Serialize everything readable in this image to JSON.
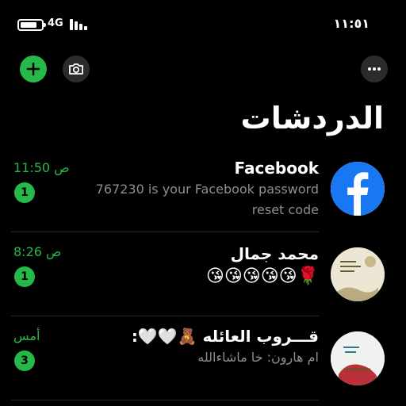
{
  "status_bar": {
    "network": "4G",
    "time": "١١:٥١"
  },
  "header": {
    "title": "الدردشات"
  },
  "chats": [
    {
      "name": "Facebook",
      "preview": "767230 is your Facebook password reset code",
      "time": "11:50 ص",
      "unread": "1",
      "avatar": "facebook-logo"
    },
    {
      "name": "محمد جمال",
      "preview": "😘😘😘😘😘🌹",
      "time": "8:26 ص",
      "unread": "1",
      "avatar": "photo"
    },
    {
      "name": "قـــروب العائله 🧸🤍🤍:",
      "preview": "ام هارون: خا ماشاءالله",
      "time": "أمس",
      "unread": "3",
      "avatar": "photo"
    }
  ],
  "colors": {
    "accent": "#27b84a",
    "background": "#000000",
    "secondary_text": "#8d8d93",
    "facebook_blue": "#1877f2"
  }
}
